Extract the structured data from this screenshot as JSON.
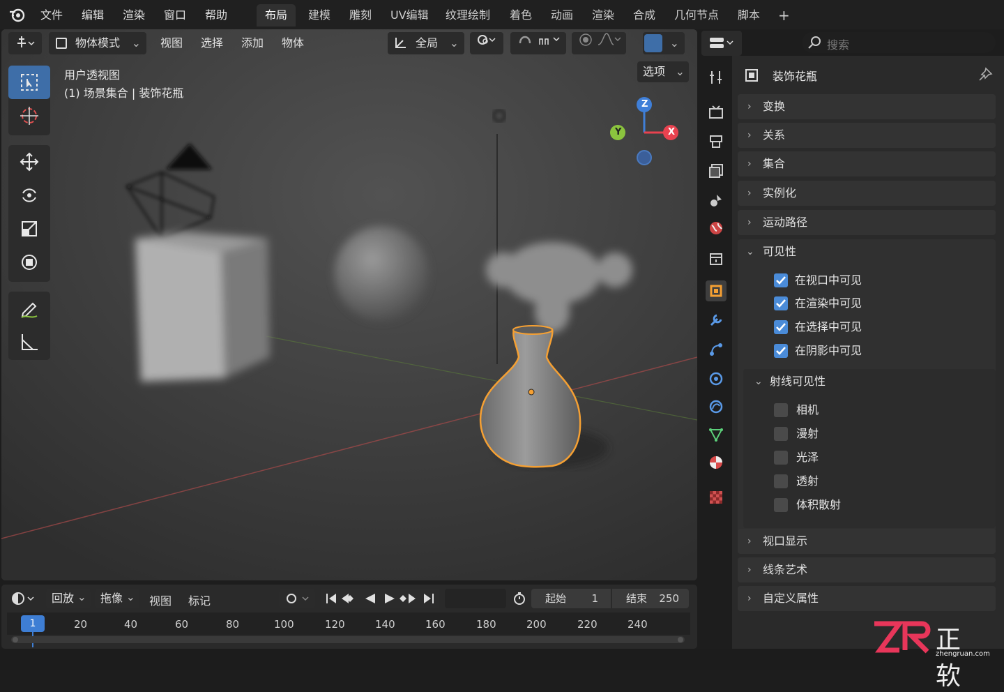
{
  "menubar": {
    "items": [
      "文件",
      "编辑",
      "渲染",
      "窗口",
      "帮助"
    ],
    "workspaces": [
      "布局",
      "建模",
      "雕刻",
      "UV编辑",
      "纹理绘制",
      "着色",
      "动画",
      "渲染",
      "合成",
      "几何节点",
      "脚本"
    ],
    "active_workspace": "布局",
    "add_tab": "+"
  },
  "viewport_header": {
    "mode": "物体模式",
    "menus": [
      "视图",
      "选择",
      "添加",
      "物体"
    ],
    "transform_orientation": "全局",
    "options": "选项"
  },
  "viewport": {
    "view_name": "用户透视图",
    "collection_info": "(1) 场景集合 | 装饰花瓶",
    "gizmo": {
      "z": "Z",
      "y": "Y",
      "x": "X"
    }
  },
  "properties": {
    "search_placeholder": "搜索",
    "object_name": "装饰花瓶",
    "panels_collapsed_top": [
      "变换",
      "关系",
      "集合",
      "实例化",
      "运动路径"
    ],
    "visibility": {
      "title": "可见性",
      "checks": [
        {
          "label": "在视口中可见",
          "checked": true
        },
        {
          "label": "在渲染中可见",
          "checked": true
        },
        {
          "label": "在选择中可见",
          "checked": true
        },
        {
          "label": "在阴影中可见",
          "checked": true
        }
      ]
    },
    "ray_visibility": {
      "title": "射线可见性",
      "checks": [
        {
          "label": "相机",
          "checked": false
        },
        {
          "label": "漫射",
          "checked": false
        },
        {
          "label": "光泽",
          "checked": false
        },
        {
          "label": "透射",
          "checked": false
        },
        {
          "label": "体积散射",
          "checked": false
        }
      ]
    },
    "panels_collapsed_bottom": [
      "视口显示",
      "线条艺术",
      "自定义属性"
    ]
  },
  "timeline": {
    "menus": [
      "回放",
      "拖像",
      "视图",
      "标记"
    ],
    "start_label": "起始",
    "start_value": "1",
    "end_label": "结束",
    "end_value": "250",
    "current_frame": "1",
    "ticks": [
      "20",
      "40",
      "60",
      "80",
      "100",
      "120",
      "140",
      "160",
      "180",
      "200",
      "220",
      "240"
    ]
  },
  "watermark": {
    "text": "正软",
    "sub": "zhengruan.com"
  },
  "colors": {
    "selection": "#f5a033",
    "accent": "#4a8bd8",
    "x_axis": "#e8424f",
    "y_axis": "#8bc43e",
    "z_axis": "#3f7fd8"
  }
}
